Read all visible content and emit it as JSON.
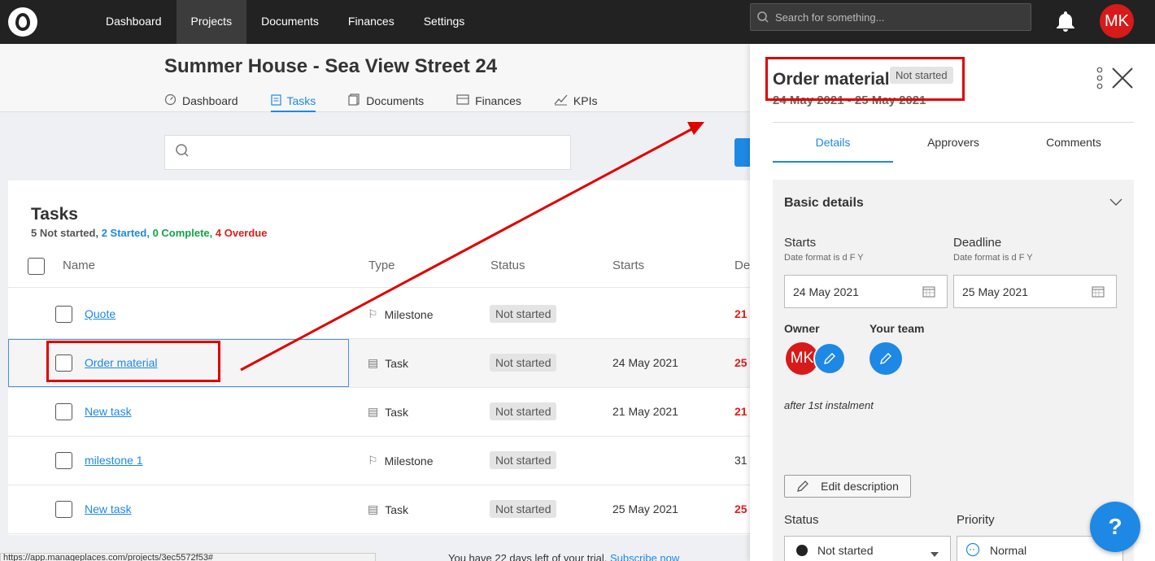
{
  "topnav": {
    "items": [
      "Dashboard",
      "Projects",
      "Documents",
      "Finances",
      "Settings"
    ],
    "active": "Projects",
    "search_placeholder": "Search for something...",
    "user_initials": "MK"
  },
  "project": {
    "title": "Summer House - Sea View Street 24",
    "tabs": [
      "Dashboard",
      "Tasks",
      "Documents",
      "Finances",
      "KPIs"
    ],
    "active_tab": "Tasks"
  },
  "tasks": {
    "title": "Tasks",
    "summary": {
      "not_started": "5 Not started,",
      "started": "2 Started,",
      "complete": "0 Complete,",
      "overdue": "4 Overdue"
    },
    "columns": [
      "Name",
      "Type",
      "Status",
      "Starts",
      "De"
    ],
    "rows": [
      {
        "name": "Quote",
        "type": "Milestone",
        "status": "Not started",
        "starts": "",
        "deadline": "21",
        "deadline_color": "#e01c1c"
      },
      {
        "name": "Order material",
        "type": "Task",
        "status": "Not started",
        "starts": "24 May 2021",
        "deadline": "25",
        "deadline_color": "#e01c1c"
      },
      {
        "name": "New task",
        "type": "Task",
        "status": "Not started",
        "starts": "21 May 2021",
        "deadline": "21",
        "deadline_color": "#e01c1c"
      },
      {
        "name": "milestone 1",
        "type": "Milestone",
        "status": "Not started",
        "starts": "",
        "deadline": "31",
        "deadline_color": "#333333"
      },
      {
        "name": "New task",
        "type": "Task",
        "status": "Not started",
        "starts": "25 May 2021",
        "deadline": "25",
        "deadline_color": "#e01c1c"
      }
    ]
  },
  "footer": {
    "url": "https://app.manageplaces.com/projects/3ec5572f53#",
    "trial_text": "You have 22 days left of your trial.",
    "subscribe_link": "Subscribe now"
  },
  "panel": {
    "title": "Order material",
    "status_badge": "Not started",
    "dates": "24 May 2021 - 25 May 2021",
    "tabs": [
      "Details",
      "Approvers",
      "Comments"
    ],
    "active_tab": "Details",
    "section_title": "Basic details",
    "starts_label": "Starts",
    "starts_hint": "Date format is d F Y",
    "starts_value": "24 May 2021",
    "deadline_label": "Deadline",
    "deadline_hint": "Date format is d F Y",
    "deadline_value": "25 May 2021",
    "owner_label": "Owner",
    "owner_initials": "MK",
    "team_label": "Your team",
    "description": "after 1st instalment",
    "edit_description_label": "Edit description",
    "status_label": "Status",
    "status_value": "Not started",
    "priority_label": "Priority",
    "priority_value": "Normal"
  },
  "help_label": "?",
  "colors": {
    "accent": "#1e88e5",
    "overdue": "#e01c1c",
    "complete": "#12a34a",
    "annotation": "#e00000"
  }
}
